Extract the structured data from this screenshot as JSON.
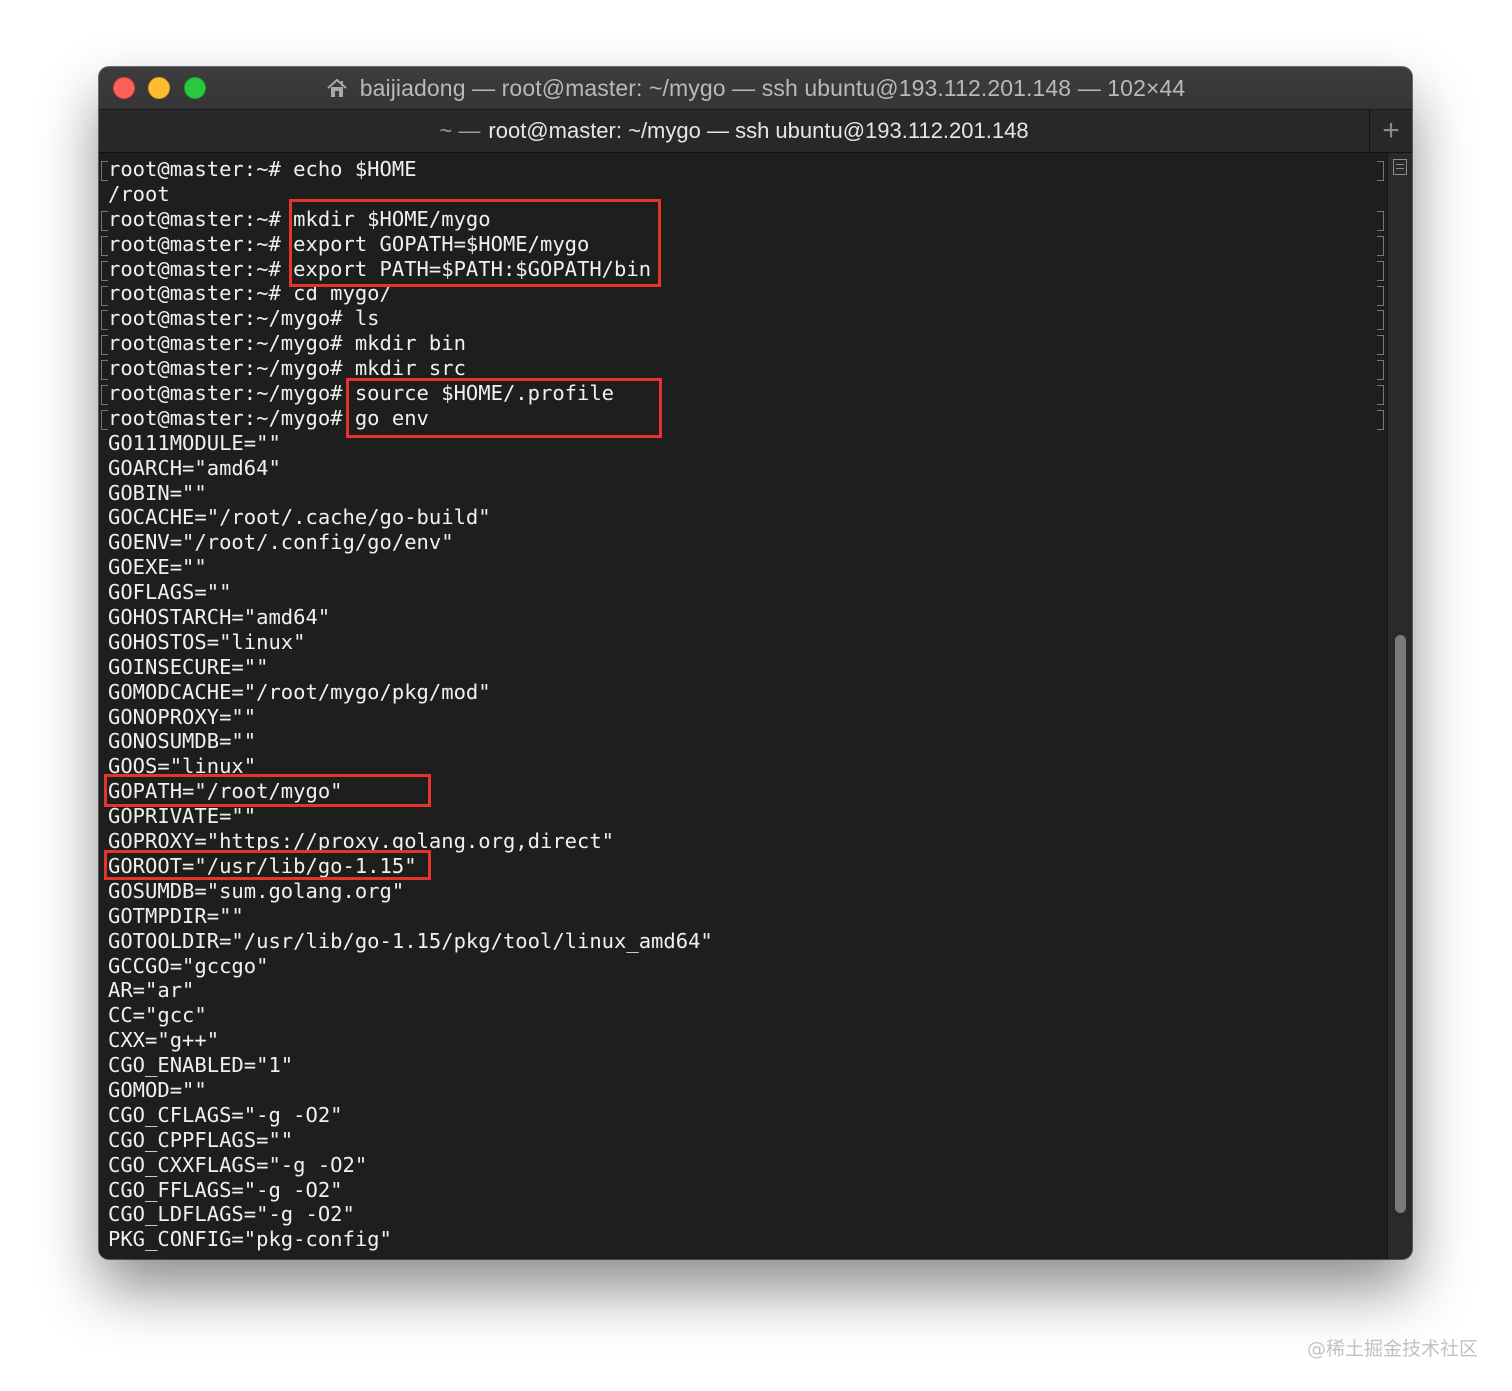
{
  "window": {
    "title": "baijiadong — root@master: ~/mygo — ssh ubuntu@193.112.201.148 — 102×44",
    "title_icon": "home-icon"
  },
  "tab": {
    "prefix": "~ —",
    "label": "root@master: ~/mygo — ssh ubuntu@193.112.201.148",
    "add_button": "+"
  },
  "terminal": {
    "lines": [
      "root@master:~# echo $HOME",
      "/root",
      "root@master:~# mkdir $HOME/mygo",
      "root@master:~# export GOPATH=$HOME/mygo",
      "root@master:~# export PATH=$PATH:$GOPATH/bin",
      "root@master:~# cd mygo/",
      "root@master:~/mygo# ls",
      "root@master:~/mygo# mkdir bin",
      "root@master:~/mygo# mkdir src",
      "root@master:~/mygo# source $HOME/.profile",
      "root@master:~/mygo# go env",
      "GO111MODULE=\"\"",
      "GOARCH=\"amd64\"",
      "GOBIN=\"\"",
      "GOCACHE=\"/root/.cache/go-build\"",
      "GOENV=\"/root/.config/go/env\"",
      "GOEXE=\"\"",
      "GOFLAGS=\"\"",
      "GOHOSTARCH=\"amd64\"",
      "GOHOSTOS=\"linux\"",
      "GOINSECURE=\"\"",
      "GOMODCACHE=\"/root/mygo/pkg/mod\"",
      "GONOPROXY=\"\"",
      "GONOSUMDB=\"\"",
      "GOOS=\"linux\"",
      "GOPATH=\"/root/mygo\"",
      "GOPRIVATE=\"\"",
      "GOPROXY=\"https://proxy.golang.org,direct\"",
      "GOROOT=\"/usr/lib/go-1.15\"",
      "GOSUMDB=\"sum.golang.org\"",
      "GOTMPDIR=\"\"",
      "GOTOOLDIR=\"/usr/lib/go-1.15/pkg/tool/linux_amd64\"",
      "GCCGO=\"gccgo\"",
      "AR=\"ar\"",
      "CC=\"gcc\"",
      "CXX=\"g++\"",
      "CGO_ENABLED=\"1\"",
      "GOMOD=\"\"",
      "CGO_CFLAGS=\"-g -O2\"",
      "CGO_CPPFLAGS=\"\"",
      "CGO_CXXFLAGS=\"-g -O2\"",
      "CGO_FFLAGS=\"-g -O2\"",
      "CGO_LDFLAGS=\"-g -O2\"",
      "PKG_CONFIG=\"pkg-config\""
    ]
  },
  "colors": {
    "highlight": "#e5352b",
    "terminal_bg": "#1e1e1e",
    "terminal_fg": "#f0f0f0"
  },
  "watermark": "@稀土掘金技术社区"
}
